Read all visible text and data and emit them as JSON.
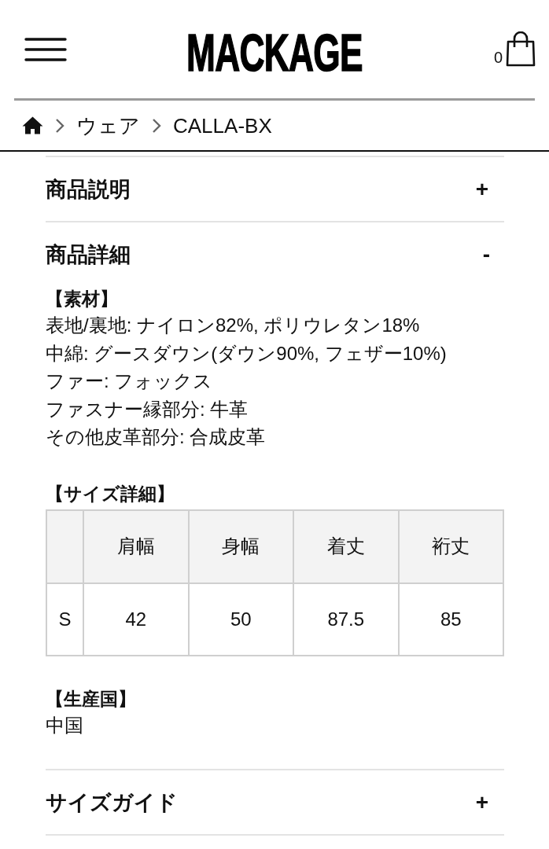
{
  "header": {
    "logo": "MACKAGE",
    "cart_count": "0"
  },
  "breadcrumb": [
    {
      "kind": "home"
    },
    {
      "kind": "link",
      "label": "ウェア"
    },
    {
      "kind": "link",
      "label": "CALLA-BX"
    }
  ],
  "accordion": [
    {
      "title": "商品説明",
      "toggle": "+",
      "expanded": false
    },
    {
      "title": "商品詳細",
      "toggle": "-",
      "expanded": true,
      "sections": [
        {
          "kind": "text",
          "heading": "【素材】",
          "lines": [
            "表地/裏地: ナイロン82%, ポリウレタン18%",
            "中綿: グースダウン(ダウン90%, フェザー10%)",
            "ファー: フォックス",
            "ファスナー縁部分: 牛革",
            "その他皮革部分: 合成皮革"
          ]
        },
        {
          "kind": "table",
          "heading": "【サイズ詳細】",
          "columns": [
            "肩幅",
            "身幅",
            "着丈",
            "裄丈"
          ],
          "rows": [
            {
              "label": "S",
              "cells": [
                "42",
                "50",
                "87.5",
                "85"
              ]
            }
          ]
        },
        {
          "kind": "text",
          "heading": "【生産国】",
          "lines": [
            "中国"
          ]
        }
      ]
    },
    {
      "title": "サイズガイド",
      "toggle": "+",
      "expanded": false
    }
  ]
}
